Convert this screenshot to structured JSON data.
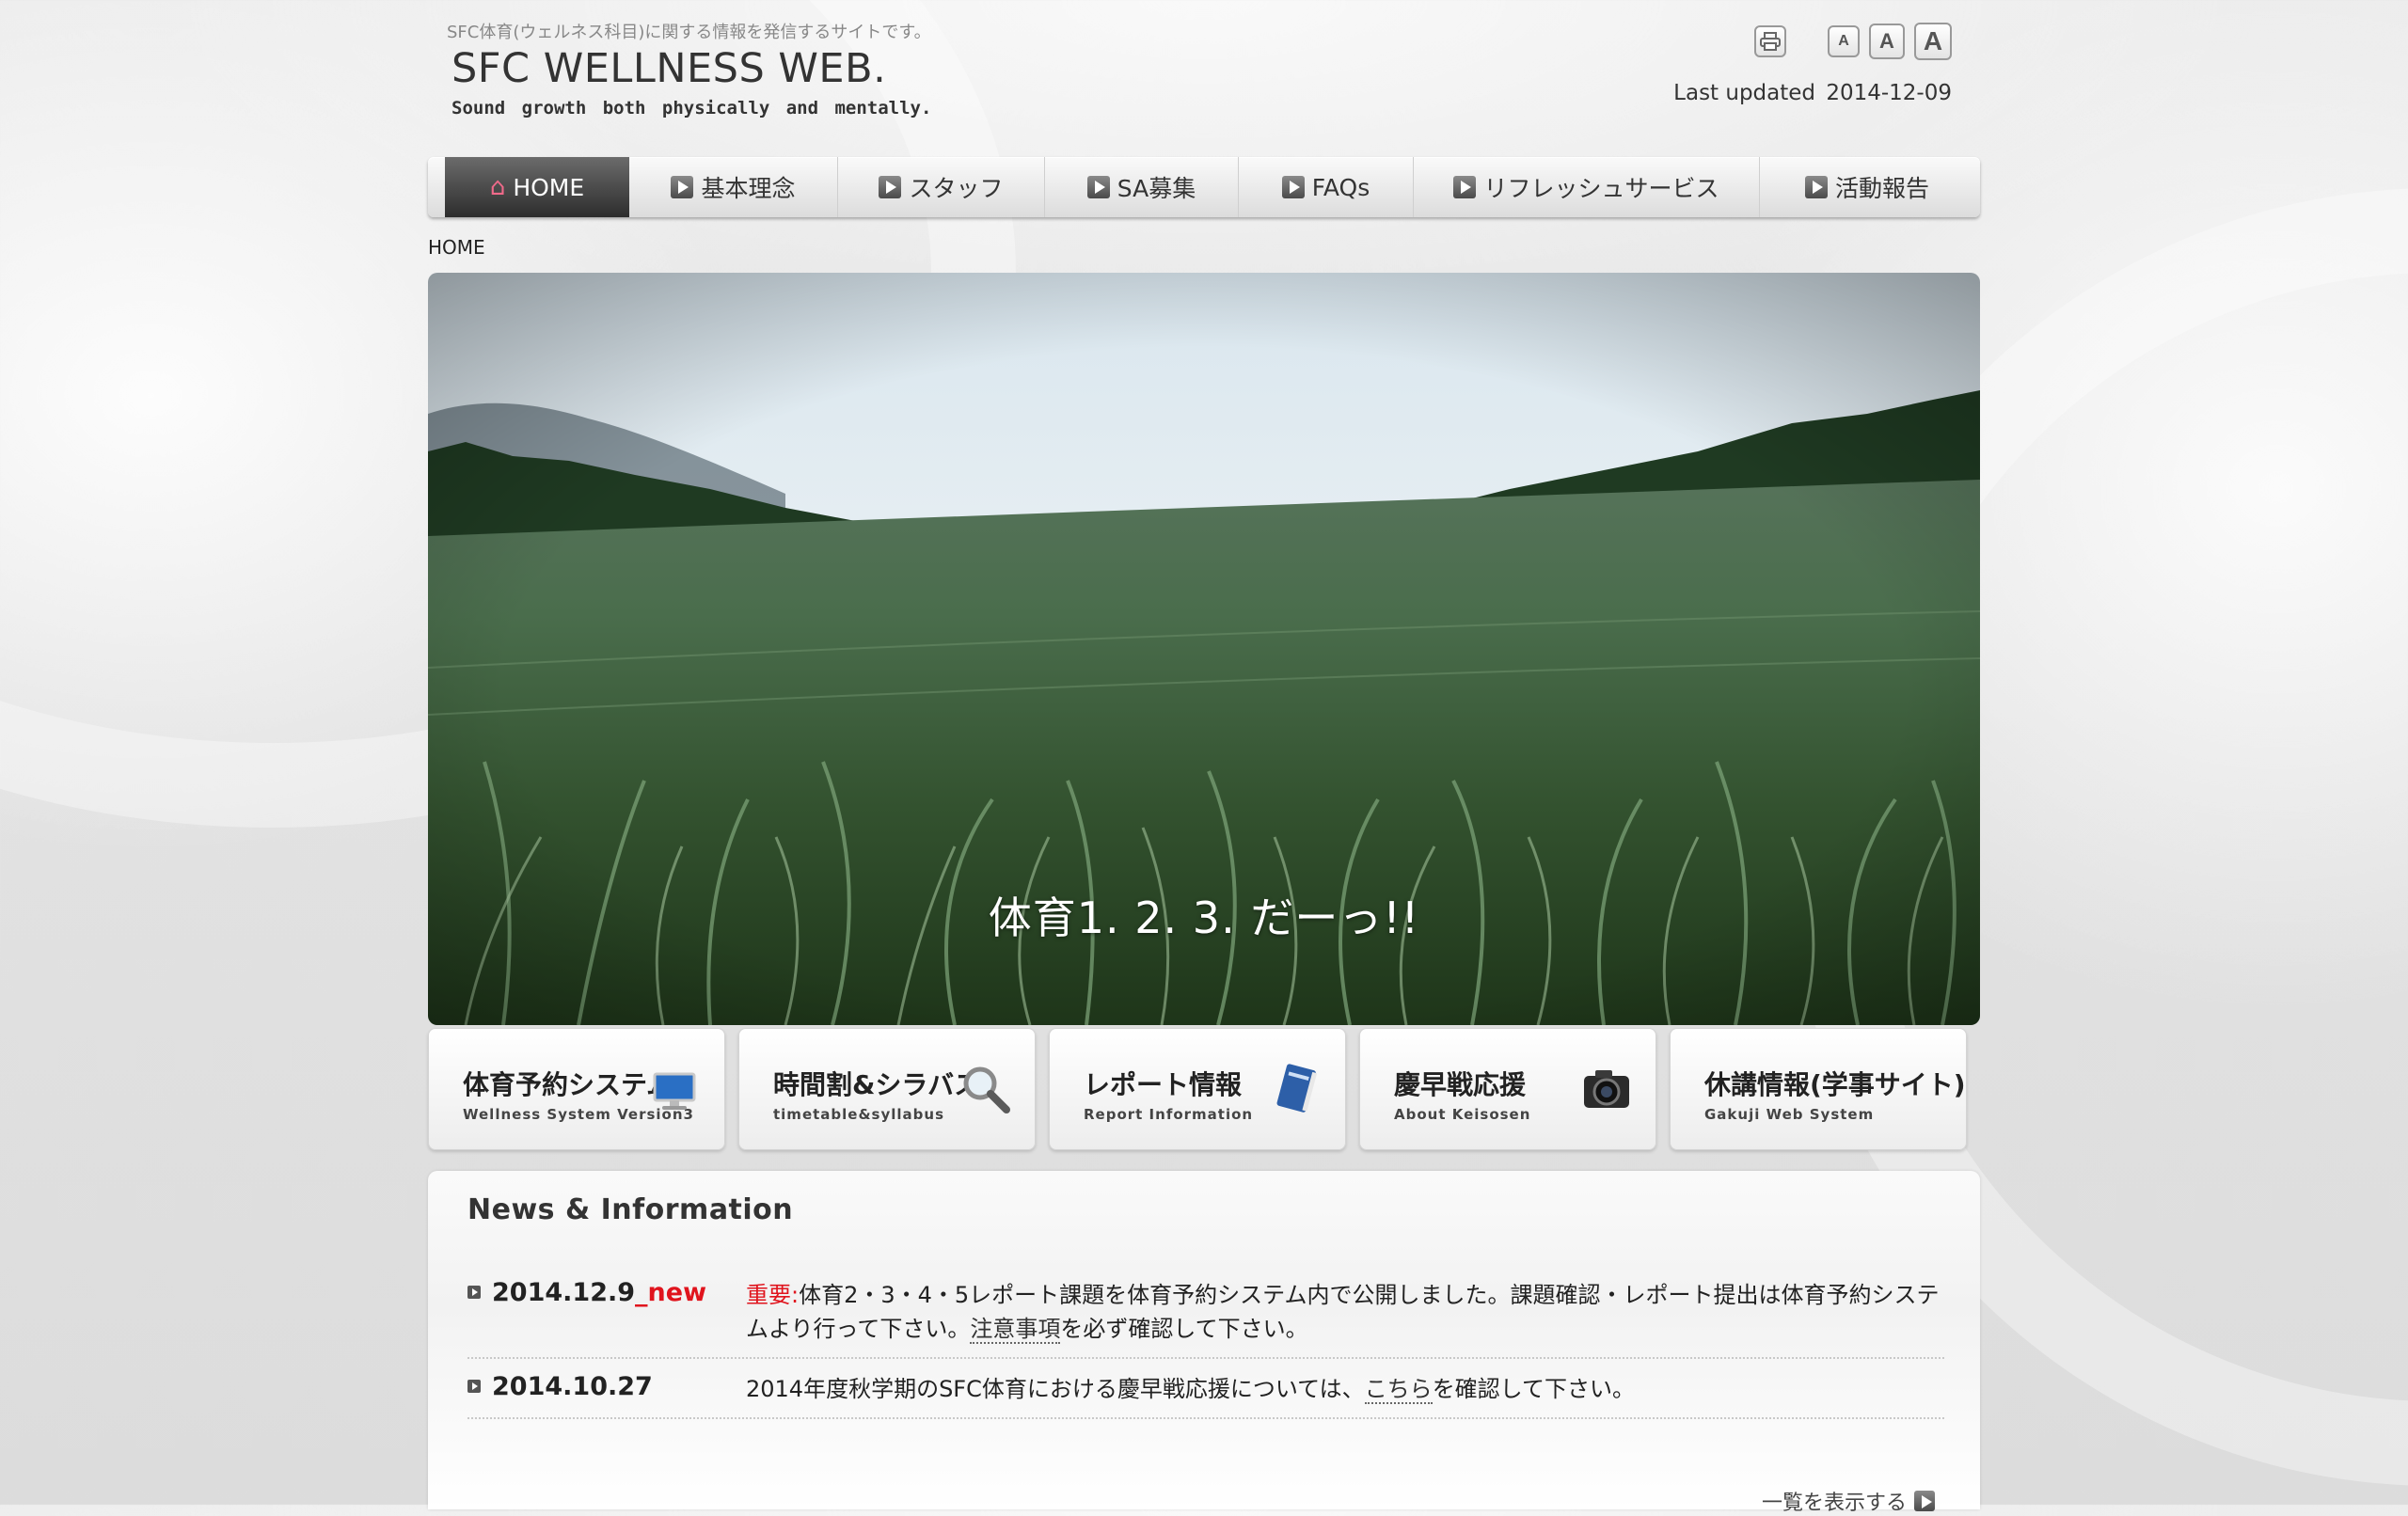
{
  "header": {
    "tagline": "SFC体育(ウェルネス科目)に関する情報を発信するサイトです。",
    "logo_title": "SFC WELLNESS WEB.",
    "logo_sub": "Sound growth both physically and mentally.",
    "font_small_label": "A",
    "font_medium_label": "A",
    "font_large_label": "A",
    "updated_label": "Last updated",
    "updated_date": "2014-12-09"
  },
  "nav": {
    "items": [
      {
        "label": "HOME",
        "icon": "home-icon",
        "active": true
      },
      {
        "label": "基本理念",
        "icon": "play-icon"
      },
      {
        "label": "スタッフ",
        "icon": "play-icon"
      },
      {
        "label": "SA募集",
        "icon": "play-icon"
      },
      {
        "label": "FAQs",
        "icon": "play-icon"
      },
      {
        "label": "リフレッシュサービス",
        "icon": "play-icon"
      },
      {
        "label": "活動報告",
        "icon": "play-icon"
      }
    ]
  },
  "breadcrumb": "HOME",
  "hero": {
    "caption": "体育1. 2. 3. だーっ!!"
  },
  "quick_links": [
    {
      "title": "体育予約システム",
      "sub": "Wellness System Version3",
      "icon": "monitor-icon"
    },
    {
      "title": "時間割&シラバス",
      "sub": "timetable&syllabus",
      "icon": "magnifier-icon"
    },
    {
      "title": "レポート情報",
      "sub": "Report Information",
      "icon": "book-icon"
    },
    {
      "title": "慶早戦応援",
      "sub": "About Keisosen",
      "icon": "camera-icon"
    },
    {
      "title": "休講情報(学事サイト)",
      "sub": "Gakuji Web System",
      "icon": ""
    }
  ],
  "news": {
    "title": "News & Information",
    "items": [
      {
        "date": "2014.12.9",
        "new_tag": "_new",
        "important": "重要:",
        "text_before": "体育2・3・4・5レポート課題を体育予約システム内で公開しました。課題確認・レポート提出は体育予約システムより行って下さい。",
        "link": "注意事項",
        "text_after": "を必ず確認して下さい。"
      },
      {
        "date": "2014.10.27",
        "new_tag": "",
        "important": "",
        "text_before": "2014年度秋学期のSFC体育における慶早戦応援については、",
        "link": "こちら",
        "text_after": "を確認して下さい。"
      }
    ],
    "more_label": "一覧を表示する"
  },
  "colors": {
    "accent_red": "#e0141d",
    "nav_active": "#3a3a3a",
    "home_icon": "#f06a8a"
  }
}
